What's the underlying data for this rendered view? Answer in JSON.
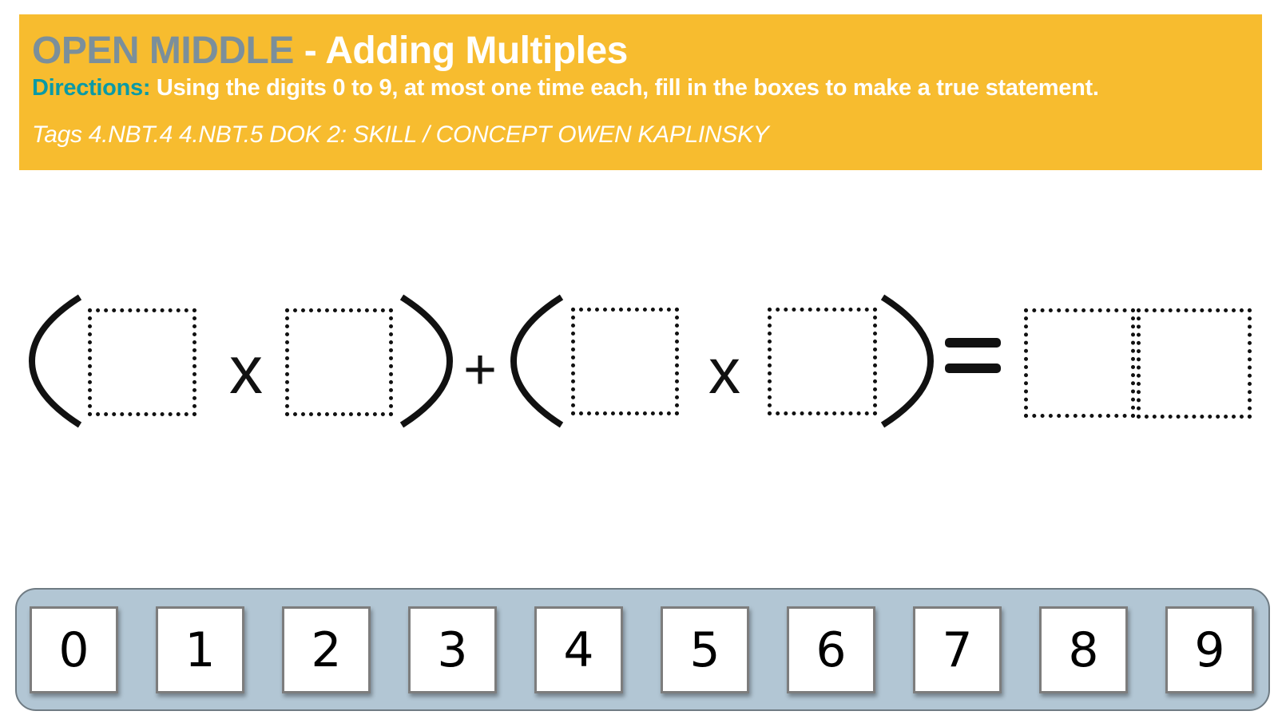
{
  "header": {
    "title_prefix": "OPEN MIDDLE",
    "title_suffix": " - Adding Multiples",
    "directions_label": "Directions:",
    "directions_text": " Using the digits 0 to 9, at most one time each, fill in the boxes to make a true statement.",
    "tags": "Tags 4.NBT.4 4.NBT.5 DOK 2: SKILL / CONCEPT OWEN KAPLINSKY",
    "colors": {
      "banner": "#f7bc2f",
      "title_prefix": "#7b8f9b",
      "directions_label": "#0a9aa6"
    }
  },
  "equation": {
    "times_1": "x",
    "plus": "+",
    "times_2": "x",
    "equals": "=",
    "box_count": 6
  },
  "digit_tray": {
    "digits": [
      "0",
      "1",
      "2",
      "3",
      "4",
      "5",
      "6",
      "7",
      "8",
      "9"
    ],
    "colors": {
      "tray": "#b2c6d4"
    }
  }
}
